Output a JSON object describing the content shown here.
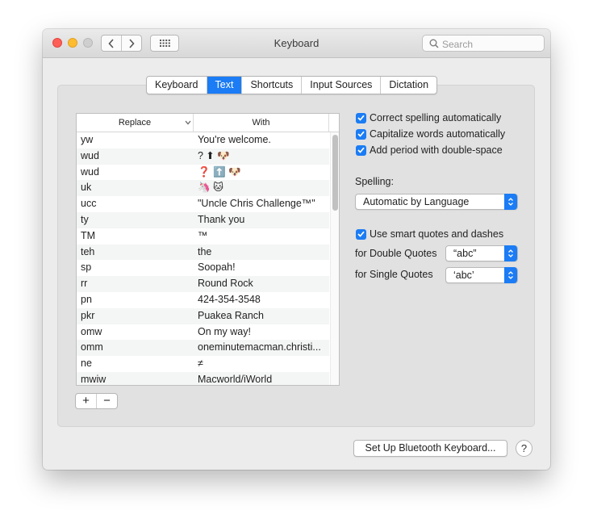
{
  "window": {
    "title": "Keyboard",
    "search": {
      "placeholder": "Search",
      "value": ""
    }
  },
  "tabs": [
    {
      "label": "Keyboard",
      "selected": false
    },
    {
      "label": "Text",
      "selected": true
    },
    {
      "label": "Shortcuts",
      "selected": false
    },
    {
      "label": "Input Sources",
      "selected": false
    },
    {
      "label": "Dictation",
      "selected": false
    }
  ],
  "table": {
    "columns": {
      "replace": "Replace",
      "with": "With"
    },
    "rows": [
      {
        "replace": "yw",
        "with": "You're welcome."
      },
      {
        "replace": "wud",
        "with": "? ⬆ 🐶"
      },
      {
        "replace": "wud",
        "with": "❓ ⬆️ 🐶"
      },
      {
        "replace": "uk",
        "with": "🦄 🐱"
      },
      {
        "replace": "ucc",
        "with": "\"Uncle Chris Challenge™\""
      },
      {
        "replace": "ty",
        "with": "Thank you"
      },
      {
        "replace": "TM",
        "with": "™"
      },
      {
        "replace": "teh",
        "with": "the"
      },
      {
        "replace": "sp",
        "with": "Soopah!"
      },
      {
        "replace": "rr",
        "with": "Round Rock"
      },
      {
        "replace": "pn",
        "with": "424-354-3548"
      },
      {
        "replace": "pkr",
        "with": "Puakea Ranch"
      },
      {
        "replace": "omw",
        "with": "On my way!"
      },
      {
        "replace": "omm",
        "with": "oneminutemacman.christi..."
      },
      {
        "replace": "ne",
        "with": "≠"
      },
      {
        "replace": "mwiw",
        "with": "Macworld/iWorld"
      }
    ]
  },
  "options": {
    "correct_spelling": {
      "label": "Correct spelling automatically",
      "checked": true
    },
    "capitalize_words": {
      "label": "Capitalize words automatically",
      "checked": true
    },
    "period_double_space": {
      "label": "Add period with double-space",
      "checked": true
    },
    "spelling_label": "Spelling:",
    "spelling_value": "Automatic by Language",
    "smart_quotes": {
      "label": "Use smart quotes and dashes",
      "checked": true
    },
    "double_quotes_label": "for Double Quotes",
    "double_quotes_value": "“abc”",
    "single_quotes_label": "for Single Quotes",
    "single_quotes_value": "‘abc’"
  },
  "buttons": {
    "add": "+",
    "remove": "−",
    "bluetooth": "Set Up Bluetooth Keyboard...",
    "help": "?"
  },
  "colors": {
    "accent": "#1b7cf5",
    "panel": "#e1e1e1",
    "window": "#ececec"
  }
}
